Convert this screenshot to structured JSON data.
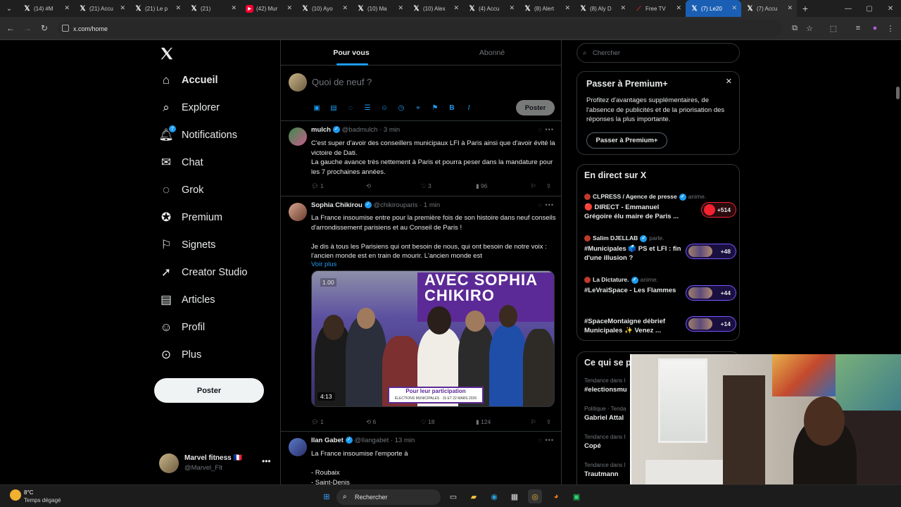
{
  "browser": {
    "tabs": [
      {
        "icon": "x-icon",
        "label": "(14) #M"
      },
      {
        "icon": "x-icon",
        "label": "(21) Accu"
      },
      {
        "icon": "x-icon",
        "label": "(21) Le p"
      },
      {
        "icon": "x-icon",
        "label": "(21)"
      },
      {
        "icon": "youtube-icon",
        "label": "(42) Mur"
      },
      {
        "icon": "x-icon",
        "label": "(10) Ayo"
      },
      {
        "icon": "x-icon",
        "label": "(10) Ma"
      },
      {
        "icon": "x-icon",
        "label": "(10) Alex"
      },
      {
        "icon": "x-icon",
        "label": "(4) Accu"
      },
      {
        "icon": "x-icon",
        "label": "(8) Alert"
      },
      {
        "icon": "x-icon",
        "label": "(8) Aly D"
      },
      {
        "icon": "free-icon",
        "label": "Free TV"
      },
      {
        "icon": "x-icon",
        "label": "(7) Le20",
        "active": true
      },
      {
        "icon": "x-icon",
        "label": "(7) Accu"
      }
    ],
    "url": "x.com/home"
  },
  "nav": {
    "items": [
      {
        "icon": "home-icon",
        "label": "Accueil",
        "active": true
      },
      {
        "icon": "explore-icon",
        "label": "Explorer"
      },
      {
        "icon": "bell-icon",
        "label": "Notifications",
        "badge": "7"
      },
      {
        "icon": "chat-icon",
        "label": "Chat"
      },
      {
        "icon": "grok-icon",
        "label": "Grok"
      },
      {
        "icon": "premium-icon",
        "label": "Premium"
      },
      {
        "icon": "bookmark-icon",
        "label": "Signets"
      },
      {
        "icon": "rocket-icon",
        "label": "Creator Studio"
      },
      {
        "icon": "articles-icon",
        "label": "Articles"
      },
      {
        "icon": "profile-icon",
        "label": "Profil"
      },
      {
        "icon": "more-icon",
        "label": "Plus"
      }
    ],
    "post_label": "Poster"
  },
  "account": {
    "name": "Marvel fitness 🇫🇷",
    "handle": "@Marvel_Flt"
  },
  "feed": {
    "tabs": [
      "Pour vous",
      "Abonné"
    ],
    "composer_placeholder": "Quoi de neuf ?",
    "composer_post": "Poster",
    "tweets": [
      {
        "name": "mulch",
        "meta": "@badmulch · 3 min",
        "text": "C'est super d'avoir des conseillers municipaux LFI à Paris ainsi que d'avoir évité la victoire de Dati.\nLa gauche avance très nettement à Paris et pourra peser dans la mandature pour les 7 prochaines années.",
        "replies": "1",
        "reposts": "",
        "likes": "3",
        "views": "96"
      },
      {
        "name": "Sophia Chikirou",
        "meta": "@chikirouparis · 1 min",
        "text": "La France insoumise entre pour la première fois de son histoire dans neuf conseils d'arrondissement parisiens et au Conseil de Paris !\n\nJe dis à tous les Parisiens qui ont besoin de nous, qui ont besoin de notre voix : l'ancien monde est en train de mourir. L'ancien monde est",
        "more": "Voir plus",
        "media": {
          "speed": "1.00",
          "duration": "4:13",
          "headline": "AVEC SOPHIA CHIKIRO",
          "banner": "Pour leur participation",
          "banner_sub": "ÉLECTIONS MUNICIPALES · 15 ET 22 MARS 2026"
        },
        "replies": "1",
        "reposts": "6",
        "likes": "18",
        "views": "124"
      },
      {
        "name": "Ilan Gabet",
        "meta": "@Ilangabet · 13 min",
        "text": "La France insoumise l'emporte à\n\n- Roubaix\n- Saint-Denis"
      }
    ]
  },
  "sidebar": {
    "search_placeholder": "Chercher",
    "premium": {
      "title": "Passer à Premium+",
      "text": "Profitez d'avantages supplémentaires, de l'absence de publicités et de la priorisation des réponses la plus importante.",
      "button": "Passer à Premium+"
    },
    "live": {
      "title": "En direct sur X",
      "items": [
        {
          "host": "CLPRESS / Agence de presse",
          "action": "anime.",
          "title": "🔴 DIRECT - Emmanuel Grégoire élu maire de Paris ...",
          "count": "+514"
        },
        {
          "host": "Salim DJELLAB",
          "action": "parle.",
          "title": "#Municipales 🗳️ PS et LFI : fin d'une illusion ?",
          "count": "+48"
        },
        {
          "host": "La Dictature.",
          "action": "anime.",
          "title": "#LeVraiSpace - Les Flammes",
          "count": "+44"
        },
        {
          "host": "",
          "action": "",
          "title": "#SpaceMontaigne débrief Municipales ✨ Venez ...",
          "count": "+14"
        }
      ]
    },
    "trends": {
      "title": "Ce qui se p",
      "items": [
        {
          "context": "Tendance dans l",
          "name": "#electionsmu"
        },
        {
          "context": "Politique · Tenda",
          "name": "Gabriel Attal"
        },
        {
          "context": "Tendance dans l",
          "name": "Copé"
        },
        {
          "context": "Tendance dans l",
          "name": "Trautmann"
        }
      ]
    }
  },
  "taskbar": {
    "temp": "8°C",
    "weather": "Temps dégagé",
    "search": "Rechercher"
  }
}
